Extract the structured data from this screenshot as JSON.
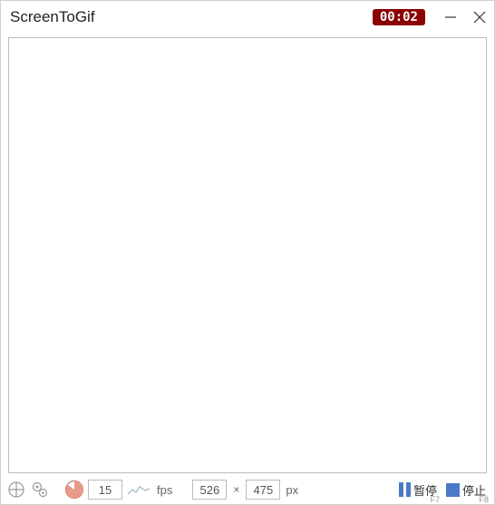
{
  "title": "ScreenToGif",
  "timer": "00:02",
  "footer": {
    "fps_value": "15",
    "fps_label": "fps",
    "width_value": "526",
    "height_value": "475",
    "px_label": "px",
    "times_symbol": "×"
  },
  "actions": {
    "pause_label": "暂停",
    "pause_hotkey": "F7",
    "stop_label": "停止",
    "stop_hotkey": "F8"
  },
  "colors": {
    "accent": "#4a7ac7",
    "timer_bg": "#8b0000",
    "pie_fill": "#e89b88"
  }
}
